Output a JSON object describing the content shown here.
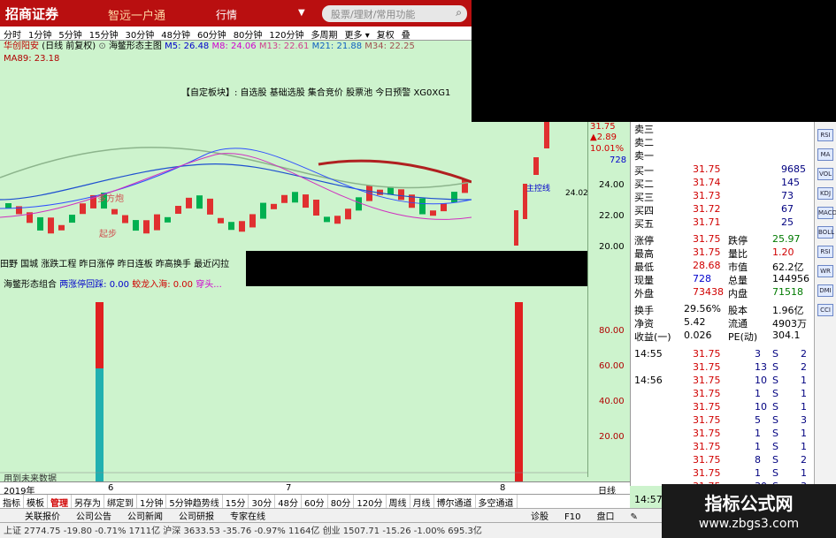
{
  "title_bar": {
    "brand": "招商证券",
    "slogan": "智远一户通",
    "menu_quote": "行情",
    "menu_arrow": "▼",
    "search_placeholder": "股票/理财/常用功能",
    "search_icon": "search-icon"
  },
  "period_bar": [
    "分时",
    "1分钟",
    "5分钟",
    "15分钟",
    "30分钟",
    "48分钟",
    "60分钟",
    "80分钟",
    "120分钟",
    "多周期",
    "更多 ▾",
    "复权",
    "叠"
  ],
  "period_active": "日线",
  "stock_line": {
    "name": "华创阳安",
    "mode": "(日线 前复权)",
    "indicator": "海鳖形态主图",
    "ma5": "M5: 26.48",
    "ma8": "M8: 24.06",
    "ma13": "M13: 22.61",
    "ma21": "M21: 21.88",
    "ma34": "M34: 22.25",
    "ma89": "MA89: 23.18"
  },
  "custom_blocks": "【自定板块】: 自选股 基础选股 集合竞价 股票池 今日预警 XG0XG1",
  "chart_annotations": {
    "duofang": "多方炮",
    "qibu": "起步",
    "ziyuan_price": "24.02",
    "zhuli": "主控线"
  },
  "price_labels": [
    "24.00",
    "22.00",
    "20.00"
  ],
  "left_info": "田野 国城 涨跌工程 昨日涨停 昨日连板 昨高换手 最近闪拉",
  "sub_indicator": {
    "title": "海鳖形态组合",
    "label1": "两涨停回踩: 0.00",
    "label2": "蛟龙入海: 0.00",
    "label3": "穿头..."
  },
  "sub_axis": [
    "80.00",
    "60.00",
    "40.00",
    "20.00"
  ],
  "sub_note": "用到未来数据",
  "date_axis": {
    "year": "2019年",
    "months": [
      "6",
      "7",
      "8"
    ],
    "mode": "日线"
  },
  "bottom_tabs": [
    "指标",
    "模板",
    "管理",
    "另存为",
    "绑定到",
    "1分钟",
    "5分钟趋势线",
    "15分",
    "30分",
    "48分",
    "60分",
    "80分",
    "120分",
    "周线",
    "月线",
    "博尔通道",
    "多空通道"
  ],
  "bottom_active": "管理",
  "quote": {
    "top_price": "31.75",
    "change": "▲2.89",
    "pct": "10.01%",
    "volume_small": "728",
    "ask": [
      {
        "label": "卖三",
        "price": "",
        "vol": ""
      },
      {
        "label": "卖二",
        "price": "",
        "vol": ""
      },
      {
        "label": "卖一",
        "price": "",
        "vol": ""
      }
    ],
    "bid": [
      {
        "label": "买一",
        "price": "31.75",
        "vol": "9685"
      },
      {
        "label": "买二",
        "price": "31.74",
        "vol": "145"
      },
      {
        "label": "买三",
        "price": "31.73",
        "vol": "73"
      },
      {
        "label": "买四",
        "price": "31.72",
        "vol": "67"
      },
      {
        "label": "买五",
        "price": "31.71",
        "vol": "25"
      }
    ],
    "stats": [
      {
        "l1": "涨停",
        "v1": "31.75",
        "c1": "red",
        "l2": "跌停",
        "v2": "25.97",
        "c2": "green"
      },
      {
        "l1": "最高",
        "v1": "31.75",
        "c1": "red",
        "l2": "量比",
        "v2": "1.20",
        "c2": "red"
      },
      {
        "l1": "最低",
        "v1": "28.68",
        "c1": "red",
        "l2": "市值",
        "v2": "62.2亿",
        "c2": "black"
      },
      {
        "l1": "现量",
        "v1": "728",
        "c1": "blue",
        "l2": "总量",
        "v2": "144956",
        "c2": "black"
      },
      {
        "l1": "外盘",
        "v1": "73438",
        "c1": "red",
        "l2": "内盘",
        "v2": "71518",
        "c2": "green"
      }
    ],
    "fin": [
      {
        "l1": "换手",
        "v1": "29.56%",
        "l2": "股本",
        "v2": "1.96亿"
      },
      {
        "l1": "净资",
        "v1": "5.42",
        "l2": "流通",
        "v2": "4903万"
      },
      {
        "l1": "收益(一)",
        "v1": "0.026",
        "l2": "PE(动)",
        "v2": "304.1"
      }
    ],
    "ticks": [
      {
        "t": "14:55",
        "p": "31.75",
        "v": "3",
        "f": "S",
        "n": "2"
      },
      {
        "t": "",
        "p": "31.75",
        "v": "13",
        "f": "S",
        "n": "2"
      },
      {
        "t": "14:56",
        "p": "31.75",
        "v": "10",
        "f": "S",
        "n": "1"
      },
      {
        "t": "",
        "p": "31.75",
        "v": "1",
        "f": "S",
        "n": "1"
      },
      {
        "t": "",
        "p": "31.75",
        "v": "10",
        "f": "S",
        "n": "1"
      },
      {
        "t": "",
        "p": "31.75",
        "v": "5",
        "f": "S",
        "n": "3"
      },
      {
        "t": "",
        "p": "31.75",
        "v": "1",
        "f": "S",
        "n": "1"
      },
      {
        "t": "",
        "p": "31.75",
        "v": "1",
        "f": "S",
        "n": "1"
      },
      {
        "t": "",
        "p": "31.75",
        "v": "8",
        "f": "S",
        "n": "2"
      },
      {
        "t": "",
        "p": "31.75",
        "v": "1",
        "f": "S",
        "n": "1"
      },
      {
        "t": "",
        "p": "31.75",
        "v": "30",
        "f": "S",
        "n": "3"
      },
      {
        "t": "14:57",
        "p": "31.75",
        "v": "",
        "f": "",
        "n": ""
      },
      {
        "t": "15:00",
        "p": "",
        "v": "",
        "f": "",
        "n": ""
      }
    ]
  },
  "status_bar": {
    "items": [
      "关联报价",
      "公司公告",
      "公司新闻",
      "公司研报",
      "专家在线"
    ],
    "right": [
      "诊股",
      "F10",
      "盘口",
      "✎"
    ]
  },
  "ticker_bar": "上证 2774.75 -19.80 -0.71% 1711亿 沪深 3633.53 -35.76 -0.97% 1164亿 创业 1507.71 -15.26 -1.00% 695.3亿",
  "right_strip_icons": [
    "RSI",
    "MA",
    "VOL",
    "KDJ",
    "MACD",
    "BOLL",
    "RSI",
    "WR",
    "DMI",
    "CCI"
  ],
  "watermark": {
    "title": "指标公式网",
    "url": "www.zbgs3.com"
  }
}
